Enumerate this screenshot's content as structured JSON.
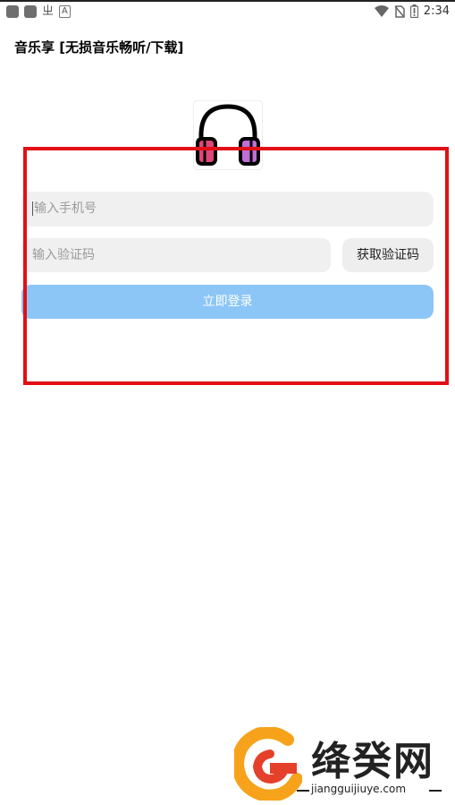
{
  "status_bar": {
    "left_glyph": "ㄓ",
    "left_small": "A",
    "time": "2:34",
    "icons": [
      "wifi-icon",
      "no-sim-icon",
      "battery-icon"
    ]
  },
  "app": {
    "title": "音乐享 [无损音乐畅听/下载]"
  },
  "logo": {
    "icon": "headphones-icon",
    "colors": {
      "outline": "#000000",
      "left_cup": "#e0457b",
      "right_cup": "#c06fd6"
    }
  },
  "form": {
    "phone_placeholder": "输入手机号",
    "code_placeholder": "输入验证码",
    "get_code_label": "获取验证码",
    "login_label": "立即登录"
  },
  "watermark": {
    "text": "绛癸网",
    "url": "jiangguijiuye.com"
  },
  "colors": {
    "highlight_frame": "#e20f16",
    "login_button": "#8cc6f7"
  }
}
